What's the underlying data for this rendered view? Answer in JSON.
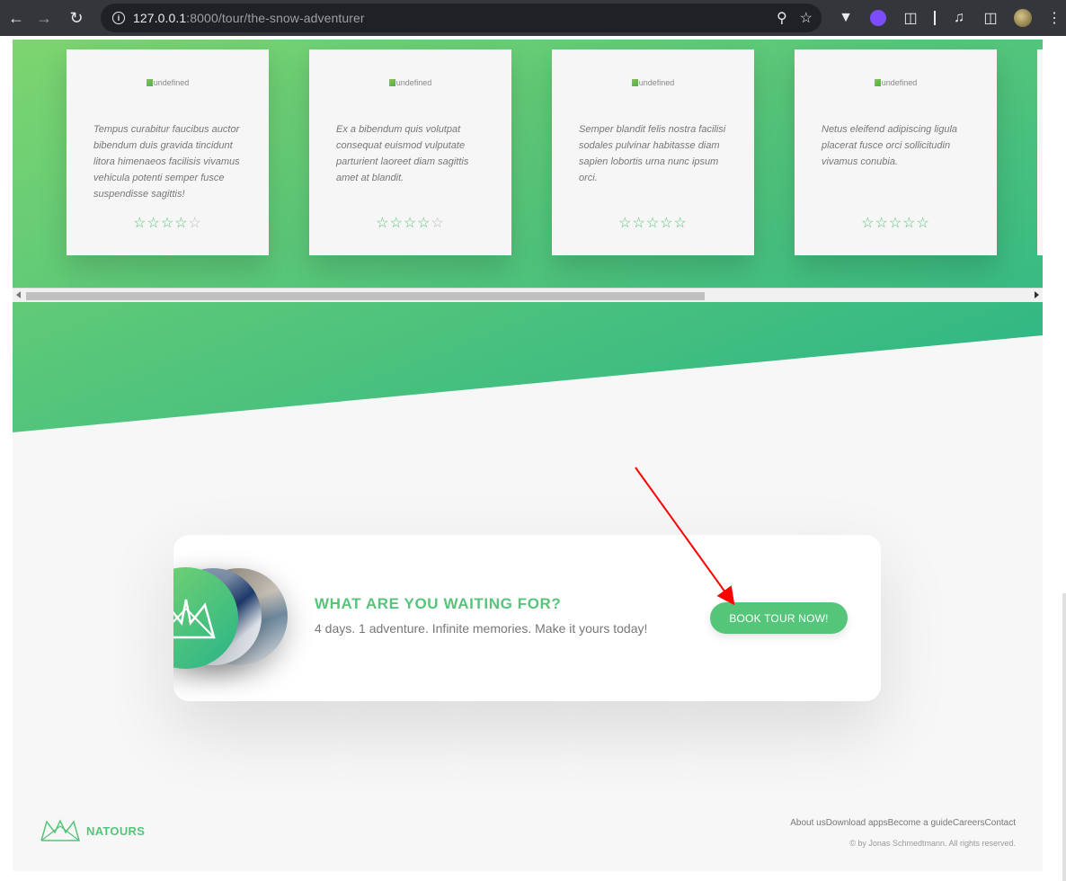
{
  "browser": {
    "url_host": "127.0.0.1",
    "url_rest": ":8000/tour/the-snow-adventurer",
    "icons": [
      "back-icon",
      "forward-icon",
      "reload-icon",
      "info-icon",
      "zoom-icon",
      "star-icon",
      "extension-icon",
      "menu-icon"
    ]
  },
  "reviews": [
    {
      "img_alt": "undefined",
      "text": "Tempus curabitur faucibus auctor bibendum duis gravida tincidunt litora himenaeos facilisis vivamus vehicula potenti semper fusce suspendisse sagittis!",
      "rating": 4
    },
    {
      "img_alt": "undefined",
      "text": "Ex a bibendum quis volutpat consequat euismod vulputate parturient laoreet diam sagittis amet at blandit.",
      "rating": 4
    },
    {
      "img_alt": "undefined",
      "text": "Semper blandit felis nostra facilisi sodales pulvinar habitasse diam sapien lobortis urna nunc ipsum orci.",
      "rating": 5
    },
    {
      "img_alt": "undefined",
      "text": "Netus eleifend adipiscing ligula placerat fusce orci sollicitudin vivamus conubia.",
      "rating": 5
    }
  ],
  "cta": {
    "title": "WHAT ARE YOU WAITING FOR?",
    "text": "4 days. 1 adventure. Infinite memories. Make it yours today!",
    "button": "BOOK TOUR NOW!"
  },
  "footer": {
    "logo_text": "NATOURS",
    "nav": [
      "About us",
      "Download apps",
      "Become a guide",
      "Careers",
      "Contact"
    ],
    "copyright": "© by Jonas Schmedtmann. All rights reserved."
  },
  "colors": {
    "accent": "#55c57a",
    "gradient_start": "#7dd56f",
    "gradient_end": "#28b487",
    "annotation_arrow": "#ff0000"
  }
}
